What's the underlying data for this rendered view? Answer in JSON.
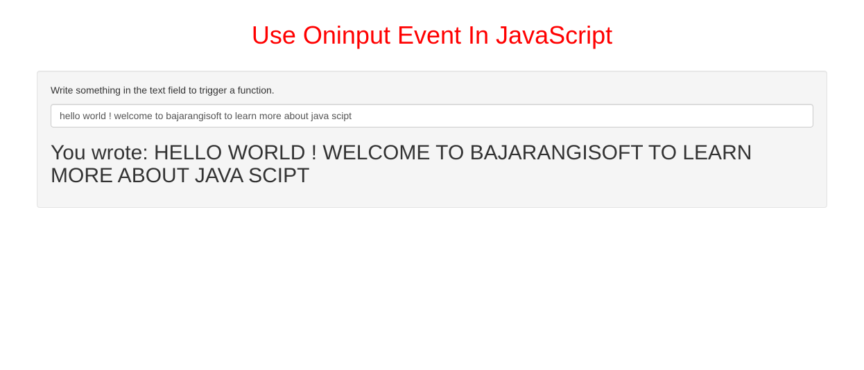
{
  "header": {
    "title": "Use Oninput Event In JavaScript"
  },
  "panel": {
    "instruction": "Write something in the text field to trigger a function.",
    "input_value": "hello world ! welcome to bajarangisoft to learn more about java scipt",
    "output_text": "You wrote: HELLO WORLD ! WELCOME TO BAJARANGISOFT TO LEARN MORE ABOUT JAVA SCIPT"
  }
}
